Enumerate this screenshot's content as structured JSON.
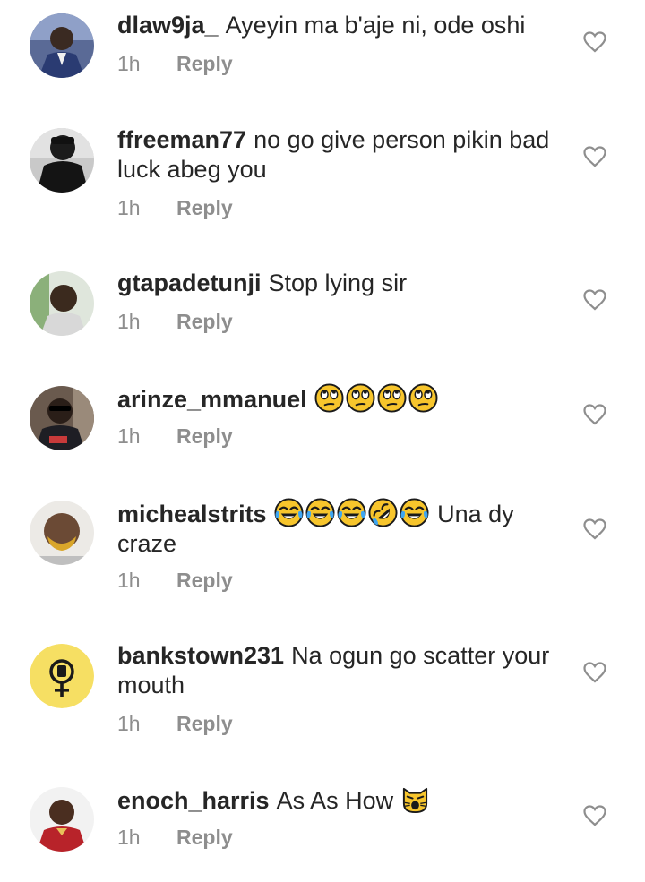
{
  "comments": [
    {
      "username": "dlaw9ja_",
      "text": "Ayeyin ma b'aje ni, ode oshi",
      "emojis": [],
      "time": "1h",
      "reply_label": "Reply"
    },
    {
      "username": "ffreeman77",
      "text": "no go give person pikin bad luck abeg you",
      "emojis": [],
      "time": "1h",
      "reply_label": "Reply"
    },
    {
      "username": "gtapadetunji",
      "text": "Stop lying sir",
      "emojis": [],
      "time": "1h",
      "reply_label": "Reply"
    },
    {
      "username": "arinze_mmanuel",
      "text": "",
      "emojis": [
        "face-with-rolling-eyes",
        "face-with-rolling-eyes",
        "face-with-rolling-eyes",
        "face-with-rolling-eyes"
      ],
      "time": "1h",
      "reply_label": "Reply"
    },
    {
      "username": "michealstrits",
      "text": "Una dy craze",
      "emojis": [
        "face-with-tears-of-joy",
        "face-with-tears-of-joy",
        "face-with-tears-of-joy",
        "rolling-on-floor-laughing",
        "face-with-tears-of-joy"
      ],
      "time": "1h",
      "reply_label": "Reply"
    },
    {
      "username": "bankstown231",
      "text": "Na ogun go scatter your mouth",
      "emojis": [],
      "time": "1h",
      "reply_label": "Reply"
    },
    {
      "username": "enoch_harris",
      "text": "As As How",
      "emojis": [
        "weary-cat"
      ],
      "time": "1h",
      "reply_label": "Reply"
    }
  ],
  "colors": {
    "text": "#262626",
    "secondary": "#8e8e8e",
    "emoji_yellow": "#f7c52c",
    "avatar_yellow": "#f6df63"
  },
  "icons": {
    "like": "heart-outline-icon"
  }
}
